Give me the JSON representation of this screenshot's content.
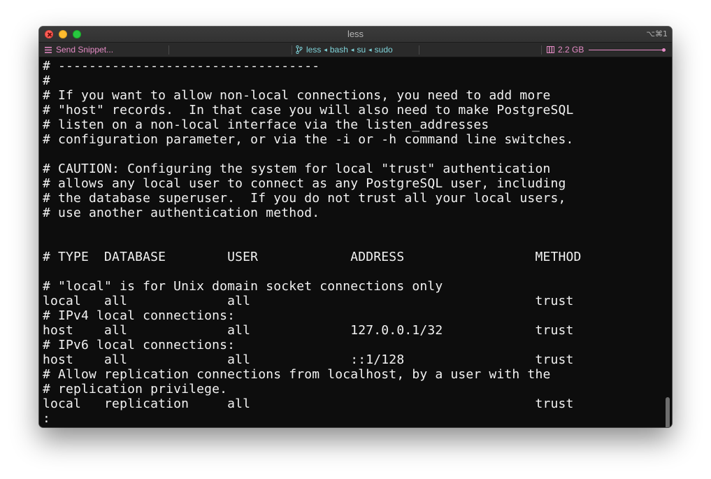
{
  "window": {
    "title": "less",
    "shortcut": "⌥⌘1"
  },
  "statusbar": {
    "snippet_label": "Send Snippet...",
    "job": "less",
    "path_1": "bash",
    "path_2": "su",
    "path_3": "sudo",
    "memory": "2.2 GB",
    "memory_level": 0.98,
    "accent_pink": "#e58bc5",
    "accent_cyan": "#7fd3d9"
  },
  "terminal": {
    "lines": [
      "# ----------------------------------",
      "#",
      "# If you want to allow non-local connections, you need to add more",
      "# \"host\" records.  In that case you will also need to make PostgreSQL",
      "# listen on a non-local interface via the listen_addresses",
      "# configuration parameter, or via the -i or -h command line switches.",
      "",
      "# CAUTION: Configuring the system for local \"trust\" authentication",
      "# allows any local user to connect as any PostgreSQL user, including",
      "# the database superuser.  If you do not trust all your local users,",
      "# use another authentication method.",
      "",
      "",
      "# TYPE  DATABASE        USER            ADDRESS                 METHOD",
      "",
      "# \"local\" is for Unix domain socket connections only",
      "local   all             all                                     trust",
      "# IPv4 local connections:",
      "host    all             all             127.0.0.1/32            trust",
      "# IPv6 local connections:",
      "host    all             all             ::1/128                 trust",
      "# Allow replication connections from localhost, by a user with the",
      "# replication privilege.",
      "local   replication     all                                     trust",
      ":"
    ]
  }
}
